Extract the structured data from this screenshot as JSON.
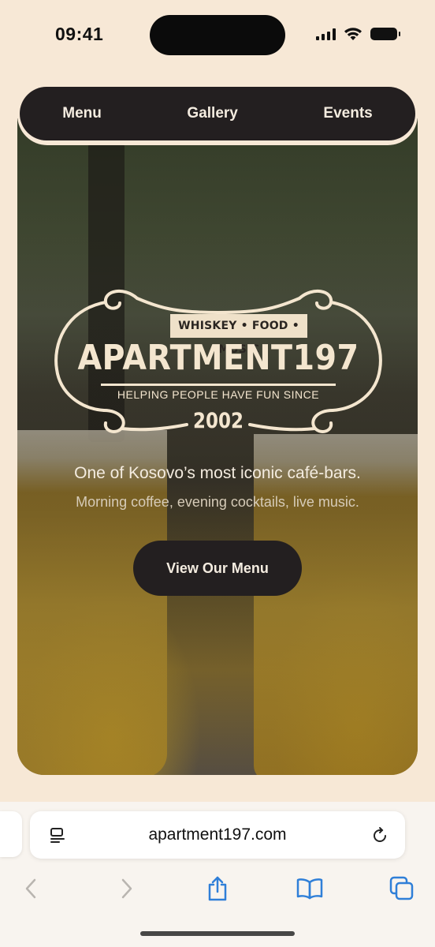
{
  "status_bar": {
    "time": "09:41"
  },
  "nav": {
    "items": [
      {
        "label": "Menu"
      },
      {
        "label": "Gallery"
      },
      {
        "label": "Events"
      }
    ]
  },
  "hero": {
    "logo": {
      "top_banner": "WHISKEY • FOOD • MUSIC",
      "name": "APARTMENT197",
      "tagline": "HELPING PEOPLE HAVE FUN SINCE",
      "year": "2002"
    },
    "headline": "One of Kosovo’s most iconic café-bars.",
    "subline": "Morning coffee, evening cocktails, live music.",
    "cta_label": "View Our Menu"
  },
  "browser": {
    "url": "apartment197.com",
    "icons": [
      "reader-icon",
      "reload-icon",
      "back-icon",
      "forward-icon",
      "share-icon",
      "bookmarks-icon",
      "tabs-icon"
    ]
  },
  "colors": {
    "page_bg": "#f7e8d6",
    "dark": "#231f20",
    "cream": "#f4e6cf",
    "accent_blue": "#2f7fd8"
  }
}
